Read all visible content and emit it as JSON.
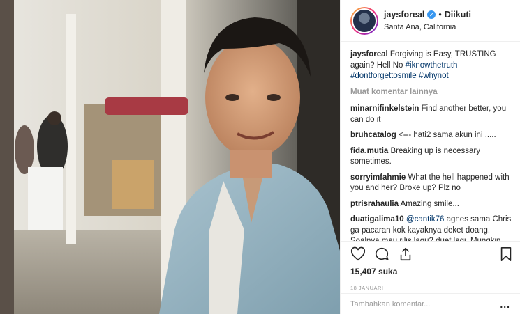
{
  "post": {
    "username": "jaysforeal",
    "follow_label": "Diikuti",
    "location": "Santa Ana, California",
    "caption": {
      "user": "jaysforeal",
      "text": "Forgiving is Easy, TRUSTING again? Hell No",
      "hashtags": [
        "#iknowthetruth",
        "#dontforgettosmile",
        "#whynot"
      ]
    },
    "load_more": "Muat komentar lainnya",
    "comments": [
      {
        "user": "minarnifinkelstein",
        "text": "Find another better, you can do it"
      },
      {
        "user": "bruhcatalog",
        "text": "<--- hati2 sama akun ini ....."
      },
      {
        "user": "fida.mutia",
        "text": "Breaking up is necessary sometimes."
      },
      {
        "user": "sorryimfahmie",
        "text": "What the hell happened with you and her? Broke up? Plz no"
      },
      {
        "user": "ptrisrahaulia",
        "text": "Amazing smile..."
      },
      {
        "user": "duatigalima10",
        "mention": "@cantik76",
        "text": "agnes sama Chris ga pacaran kok kayaknya deket doang. Soalnya mau rilis lagu2 duet lagi. Mungkin lagi bangun image doang biar ngga kerasa"
      }
    ],
    "likes": "15,407 suka",
    "date": "18 JANUARI",
    "comment_placeholder": "Tambahkan komentar...",
    "more_options": "...",
    "icons": [
      "heart-icon",
      "comment-icon",
      "share-icon",
      "bookmark-icon",
      "verified-icon"
    ],
    "colors": {
      "link": "#003569",
      "verified": "#3897f0",
      "muted": "#999999",
      "text": "#262626"
    }
  }
}
